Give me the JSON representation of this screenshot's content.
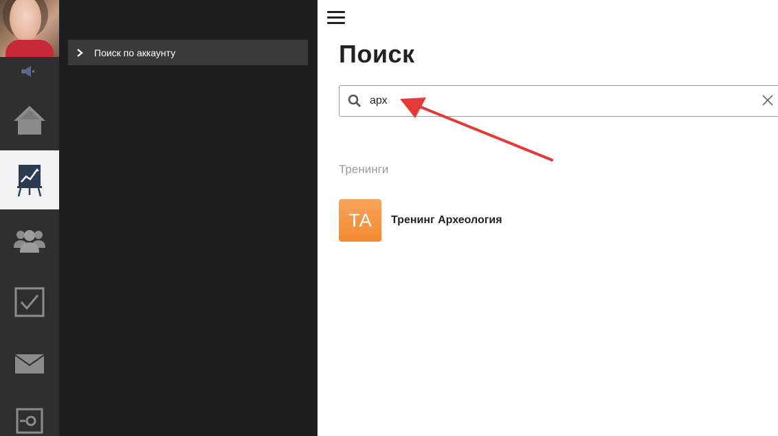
{
  "sidebar": {
    "items": [
      {
        "icon": "speaker-icon"
      },
      {
        "icon": "home-icon"
      },
      {
        "icon": "training-chart-icon",
        "active": true
      },
      {
        "icon": "users-icon"
      },
      {
        "icon": "checkbox-icon"
      },
      {
        "icon": "mail-icon"
      },
      {
        "icon": "settings-icon"
      }
    ]
  },
  "panel": {
    "item_label": "Поиск по аккаунту"
  },
  "main": {
    "title": "Поиск",
    "search": {
      "value": "арх",
      "placeholder": ""
    },
    "section_label": "Тренинги",
    "results": [
      {
        "initials": "ТА",
        "name": "Тренинг Археология"
      }
    ]
  },
  "colors": {
    "rail_bg": "#2f2f2f",
    "panel_bg": "#1f1f1f",
    "panel_item_bg": "#3a3a3a",
    "badge": "#f28a30",
    "annotation_arrow": "#e53935"
  }
}
